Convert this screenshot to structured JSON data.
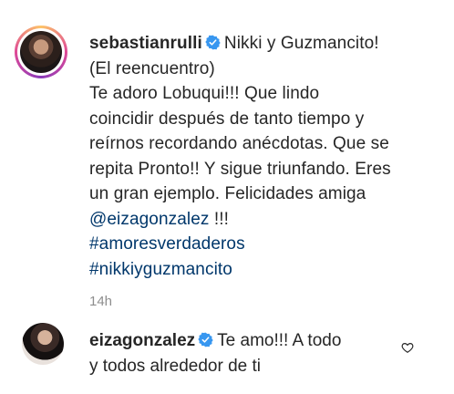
{
  "post": {
    "username": "sebastianrulli",
    "caption_lines": [
      "Nikki y Guzmancito!",
      "(El reencuentro)",
      "Te adoro Lobuqui!!! Que lindo",
      "coincidir después de tanto tiempo y",
      "reírnos recordando anécdotas. Que se",
      "repita Pronto!! Y sigue triunfando. Eres",
      "un gran ejemplo. Felicidades amiga"
    ],
    "mention": "@eizagonzalez",
    "mention_suffix": " !!!",
    "hashtags": [
      "#amoresverdaderos",
      "#nikkiyguzmancito"
    ],
    "time": "14h"
  },
  "reply": {
    "username": "eizagonzalez",
    "text_line1": "Te amo!!! A todo",
    "text_line2": "y todos alrededor de ti"
  },
  "colors": {
    "text": "#262626",
    "link": "#00376b",
    "verified": "#3897f0",
    "muted": "#8e8e8e"
  },
  "icons": {
    "verified": "verified-badge-icon",
    "like": "heart-outline-icon"
  }
}
